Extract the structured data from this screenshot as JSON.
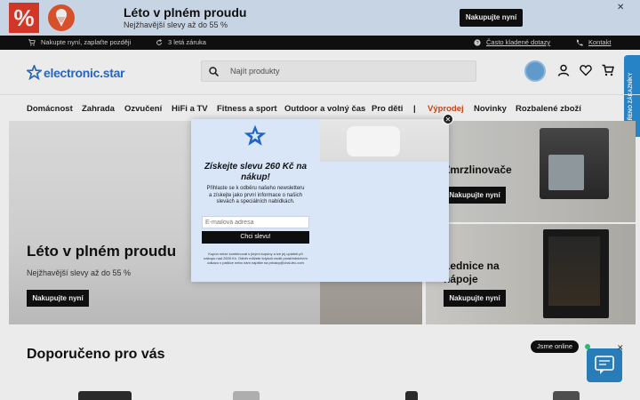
{
  "promo": {
    "title": "Léto v plném proudu",
    "subtitle": "Nejžhavější slevy až do 55 %",
    "button": "Nakupujte nyní",
    "percent_glyph": "%"
  },
  "infobar": {
    "item1": "Nakupte nyní, zaplaťte později",
    "item2": "3 letá záruka",
    "faq": "Často kladené dotazy",
    "contact": "Kontakt"
  },
  "header": {
    "logo": "electronic.star",
    "search_placeholder": "Najít produkty",
    "verified_tab": "OVĚŘENO ZÁKAZNÍKY"
  },
  "nav": {
    "items": [
      "Domácnost",
      "Zahrada",
      "Ozvučení",
      "HiFi a TV",
      "Fitness a sport",
      "Outdoor a volný čas",
      "Pro děti",
      "|",
      "Výprodej",
      "Novinky",
      "Rozbalené zboží"
    ]
  },
  "hero": {
    "title": "Léto v plném proudu",
    "subtitle": "Nejžhavější slevy až do 55 %",
    "button": "Nakupujte nyní"
  },
  "side_a": {
    "title": "Zmrzlinovače",
    "button": "Nakupujte nyní"
  },
  "side_b": {
    "title_line1": "Lednice na",
    "title_line2": "nápoje",
    "button": "Nakupujte nyní"
  },
  "recommended": {
    "title": "Doporučeno pro vás"
  },
  "chat": {
    "status": "Jsme online"
  },
  "modal": {
    "title": "Získejte slevu 260 Kč na nákup!",
    "text": "Přihlaste se k odběru našeho newsletteru a získejte jako první informace o našich slevách a speciálních nabídkách.",
    "email_placeholder": "E-mailová adresa",
    "button": "Chci slevu!",
    "fine_print": "Kupón nelze kombinovat s jinými kupóny a lze jej uplatnit při nákupu nad 2600 Kč. Odběr můžete kdykoli zrušit prostřednictvím odkazu v patičce nebo nám napište na privacy@chal-tec.com"
  },
  "colors": {
    "brand": "#2a6fcf",
    "sale": "#d84a1b",
    "promo_bg": "#d8e6f8",
    "chat": "#2c88c8"
  }
}
